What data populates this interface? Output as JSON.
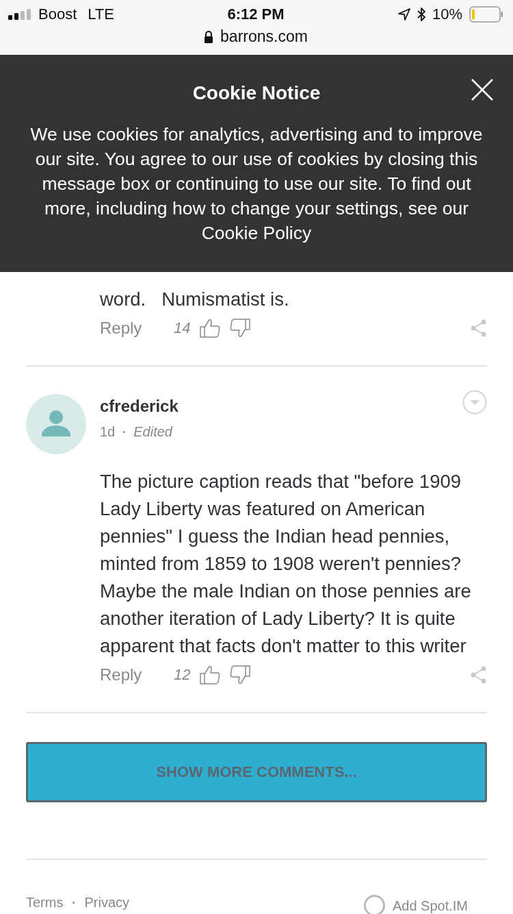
{
  "status_bar": {
    "carrier": "Boost",
    "network": "LTE",
    "time": "6:12 PM",
    "battery": "10%"
  },
  "address_bar": {
    "url": "barrons.com"
  },
  "cookie_notice": {
    "title": "Cookie Notice",
    "message": "We use cookies for analytics, advertising and to improve our site. You agree to our use of cookies by closing this message box or continuing to use our site. To find out more, including how to change your settings, see our Cookie Policy"
  },
  "comments": [
    {
      "kind": "partial",
      "text": "word.   Numismatist is.",
      "reply": "Reply",
      "likes": "14"
    },
    {
      "kind": "full",
      "author": "cfrederick",
      "age": "1d",
      "edited": "Edited",
      "text": "The picture caption reads that \"before 1909 Lady Liberty was featured on American pennies\" I guess the Indian head pennies, minted from 1859 to 1908 weren't pennies? Maybe the male Indian on those pennies are another iteration of Lady Liberty?  It is quite apparent that facts don't matter to this writer",
      "reply": "Reply",
      "likes": "12"
    }
  ],
  "show_more": "SHOW MORE COMMENTS...",
  "footer": {
    "links": [
      "Terms",
      "Privacy"
    ],
    "brand": "Add Spot.IM"
  }
}
